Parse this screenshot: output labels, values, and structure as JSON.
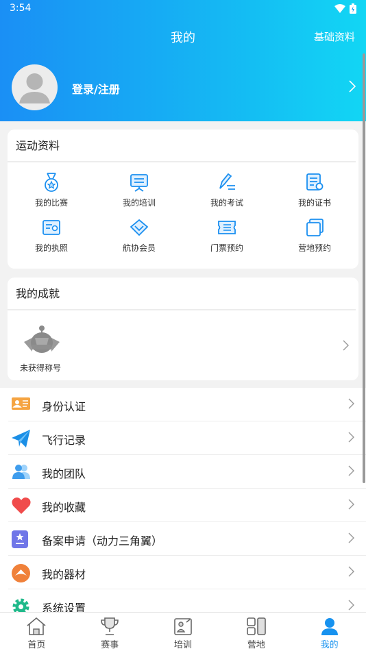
{
  "status_bar": {
    "time": "3:54"
  },
  "header": {
    "title": "我的",
    "basic_info": "基础资料",
    "login": "登录/注册"
  },
  "sports": {
    "title": "运动资料",
    "items": [
      {
        "label": "我的比赛",
        "icon": "medal-icon"
      },
      {
        "label": "我的培训",
        "icon": "easel-icon"
      },
      {
        "label": "我的考试",
        "icon": "pen-icon"
      },
      {
        "label": "我的证书",
        "icon": "certificate-icon"
      },
      {
        "label": "我的执照",
        "icon": "license-icon"
      },
      {
        "label": "航协会员",
        "icon": "diamond-icon"
      },
      {
        "label": "门票预约",
        "icon": "ticket-icon"
      },
      {
        "label": "营地预约",
        "icon": "camp-icon"
      }
    ]
  },
  "achievement": {
    "title": "我的成就",
    "badge_text": "未获得称号"
  },
  "menu": [
    {
      "label": "身份认证",
      "icon": "id-card-icon",
      "color": "#f5a442"
    },
    {
      "label": "飞行记录",
      "icon": "paper-plane-icon",
      "color": "#1b8fe6"
    },
    {
      "label": "我的团队",
      "icon": "team-icon",
      "color": "#5aaef0"
    },
    {
      "label": "我的收藏",
      "icon": "heart-icon",
      "color": "#f04b4b"
    },
    {
      "label": "备案申请（动力三角翼）",
      "icon": "filing-icon",
      "color": "#7076e8"
    },
    {
      "label": "我的器材",
      "icon": "equipment-icon",
      "color": "#f0813a"
    },
    {
      "label": "系统设置",
      "icon": "gear-icon",
      "color": "#1fb98a"
    }
  ],
  "tabs": [
    {
      "label": "首页",
      "icon": "home-icon"
    },
    {
      "label": "赛事",
      "icon": "trophy-icon"
    },
    {
      "label": "培训",
      "icon": "training-icon"
    },
    {
      "label": "营地",
      "icon": "camp-grid-icon"
    },
    {
      "label": "我的",
      "icon": "profile-icon"
    }
  ]
}
